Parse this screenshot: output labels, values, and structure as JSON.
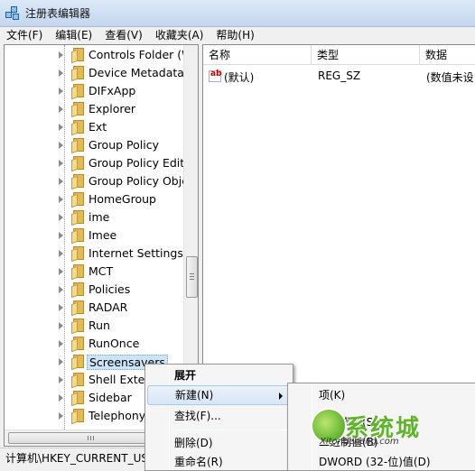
{
  "window": {
    "title": "注册表编辑器"
  },
  "menubar": [
    "文件(F)",
    "编辑(E)",
    "查看(V)",
    "收藏夹(A)",
    "帮助(H)"
  ],
  "tree": {
    "items": [
      {
        "label": "Controls Folder (W"
      },
      {
        "label": "Device Metadata"
      },
      {
        "label": "DIFxApp"
      },
      {
        "label": "Explorer"
      },
      {
        "label": "Ext"
      },
      {
        "label": "Group Policy"
      },
      {
        "label": "Group Policy Editc"
      },
      {
        "label": "Group Policy Obje"
      },
      {
        "label": "HomeGroup"
      },
      {
        "label": "ime"
      },
      {
        "label": "Imee"
      },
      {
        "label": "Internet Settings"
      },
      {
        "label": "MCT"
      },
      {
        "label": "Policies"
      },
      {
        "label": "RADAR"
      },
      {
        "label": "Run"
      },
      {
        "label": "RunOnce"
      },
      {
        "label": "Screensavers",
        "selected": true
      },
      {
        "label": "Shell Exten"
      },
      {
        "label": "Sidebar"
      },
      {
        "label": "Telephony"
      }
    ]
  },
  "values_list": {
    "columns": {
      "name": "名称",
      "type": "类型",
      "data": "数据"
    },
    "rows": [
      {
        "name": "(默认)",
        "type": "REG_SZ",
        "data": "(数值未设"
      }
    ]
  },
  "statusbar": {
    "path": "计算机\\HKEY_CURRENT_US"
  },
  "context_menu": {
    "items": [
      {
        "label": "展开",
        "bold": true
      },
      {
        "label": "新建(N)",
        "submenu": true,
        "highlighted": true
      },
      {
        "label": "查找(F)..."
      },
      {
        "label": "删除(D)"
      },
      {
        "label": "重命名(R)"
      }
    ]
  },
  "submenu": {
    "items": [
      {
        "label": "项(K)"
      },
      {
        "label": "字符串值(S)"
      },
      {
        "label": "二进制值(B)"
      },
      {
        "label": "DWORD (32-位)值(D)"
      }
    ]
  },
  "watermark": {
    "text": "系统城",
    "url": "Xitongcheng.com"
  },
  "colors": {
    "selection": "#cce4f7",
    "folder": "#e3b95a",
    "titlebar": "#c4d7ef"
  }
}
